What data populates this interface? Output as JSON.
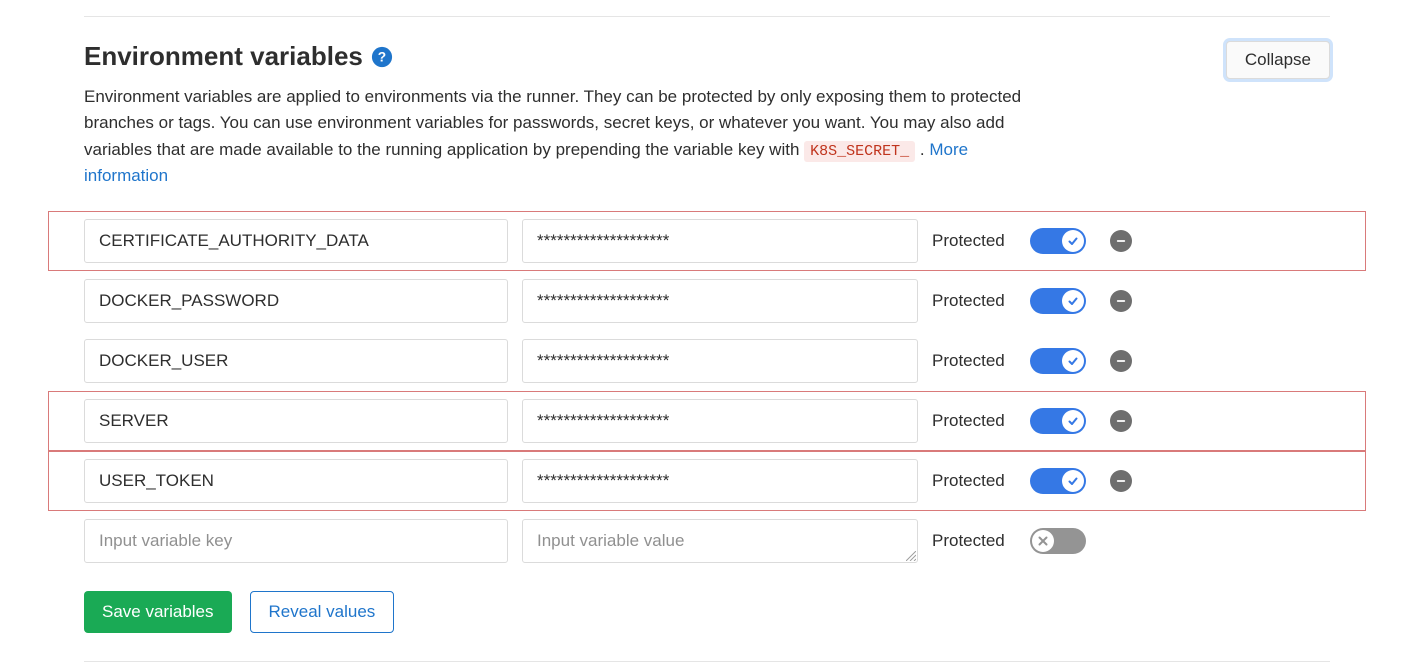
{
  "title": "Environment variables",
  "collapse": "Collapse",
  "description": {
    "part1": "Environment variables are applied to environments via the runner. They can be protected by only exposing them to protected branches or tags. You can use environment variables for passwords, secret keys, or whatever you want. You may also add variables that are made available to the running application by prepending the variable key with ",
    "code": "K8S_SECRET_",
    "part2": ". ",
    "link": "More information"
  },
  "labels": {
    "protected": "Protected"
  },
  "placeholders": {
    "key": "Input variable key",
    "value": "Input variable value"
  },
  "variables": [
    {
      "key": "CERTIFICATE_AUTHORITY_DATA",
      "value": "********************",
      "protected": true,
      "highlight": true
    },
    {
      "key": "DOCKER_PASSWORD",
      "value": "********************",
      "protected": true,
      "highlight": false
    },
    {
      "key": "DOCKER_USER",
      "value": "********************",
      "protected": true,
      "highlight": false
    },
    {
      "key": "SERVER",
      "value": "********************",
      "protected": true,
      "highlight": true
    },
    {
      "key": "USER_TOKEN",
      "value": "********************",
      "protected": true,
      "highlight": true
    }
  ],
  "buttons": {
    "save": "Save variables",
    "reveal": "Reveal values"
  }
}
